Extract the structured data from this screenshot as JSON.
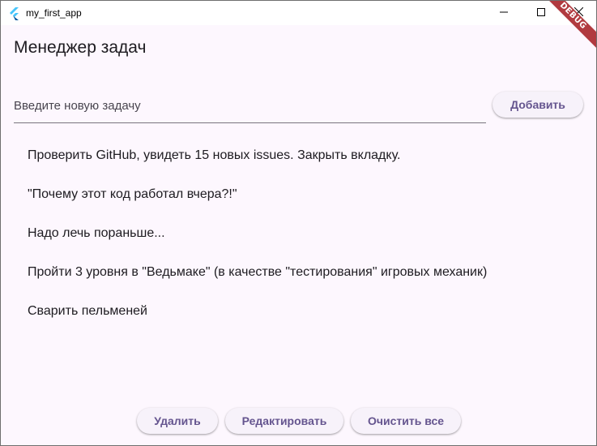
{
  "window": {
    "title": "my_first_app",
    "app_icon": "flutter-logo-icon",
    "controls": [
      "minimize-icon",
      "maximize-icon",
      "close-icon"
    ]
  },
  "debug_banner": "DEBUG",
  "app": {
    "title": "Менеджер задач"
  },
  "input": {
    "placeholder": "Введите новую задачу",
    "value": ""
  },
  "buttons": {
    "add": "Добавить",
    "delete": "Удалить",
    "edit": "Редактировать",
    "clear_all": "Очистить все"
  },
  "tasks": [
    "Проверить GitHub, увидеть 15 новых issues. Закрыть вкладку.",
    "\"Почему этот код работал вчера?!\"",
    "Надо лечь пораньше...",
    "Пройти 3 уровня в \"Ведьмаке\" (в качестве \"тестирования\" игровых механик)",
    "Сварить пельменей"
  ],
  "colors": {
    "background": "#fdf7fe",
    "button_text": "#65558f",
    "button_bg": "#f7f2fa",
    "debug_banner": "#b13a3f"
  }
}
